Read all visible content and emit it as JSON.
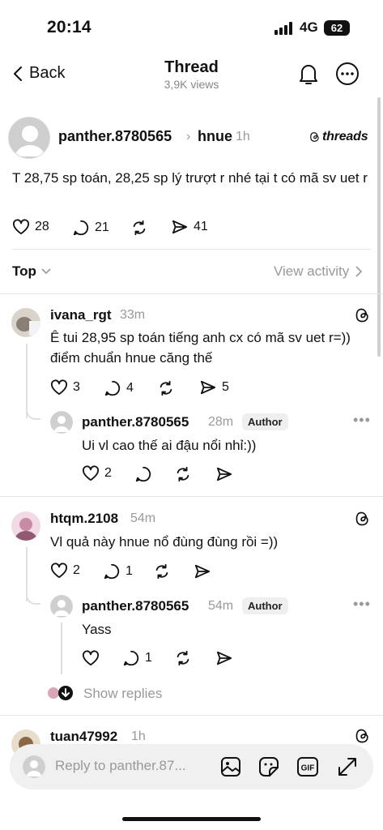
{
  "status_bar": {
    "time": "20:14",
    "network": "4G",
    "battery": "62"
  },
  "header": {
    "back_label": "Back",
    "title": "Thread",
    "views": "3,9K views"
  },
  "post": {
    "username": "panther.8780565",
    "topic": "hnue",
    "time": "1h",
    "brand": "threads",
    "text": "T 28,75 sp toán, 28,25 sp lý trượt r nhé tại t có mã sv uet r",
    "likes": "28",
    "replies": "21",
    "shares": "41"
  },
  "sort": {
    "label": "Top",
    "view_activity": "View activity"
  },
  "comments": [
    {
      "username": "ivana_rgt",
      "time": "33m",
      "text": "Ê tui 28,95 sp toán tiếng anh cx có mã sv uet r=)) điểm chuẩn hnue căng thế",
      "likes": "3",
      "replies": "4",
      "shares": "5",
      "reply": {
        "username": "panther.8780565",
        "time": "28m",
        "badge": "Author",
        "text": "Ui vl cao thế ai đậu nổi nhỉ:))",
        "likes": "2"
      }
    },
    {
      "username": "htqm.2108",
      "time": "54m",
      "text": "Vl quả này hnue nổ đùng đùng rồi =))",
      "likes": "2",
      "replies": "1",
      "reply": {
        "username": "panther.8780565",
        "time": "54m",
        "badge": "Author",
        "text": "Yass",
        "replies": "1"
      },
      "show_replies": "Show replies"
    },
    {
      "username": "tuan47992",
      "time": "1h"
    }
  ],
  "composer": {
    "placeholder": "Reply to panther.87...",
    "gif_label": "GIF"
  },
  "icons": [
    "chevron-left-icon",
    "bell-icon",
    "more-icon",
    "heart-icon",
    "comment-icon",
    "repost-icon",
    "share-icon",
    "threads-logo-icon",
    "image-icon",
    "sticker-icon",
    "gif-icon",
    "expand-icon"
  ]
}
